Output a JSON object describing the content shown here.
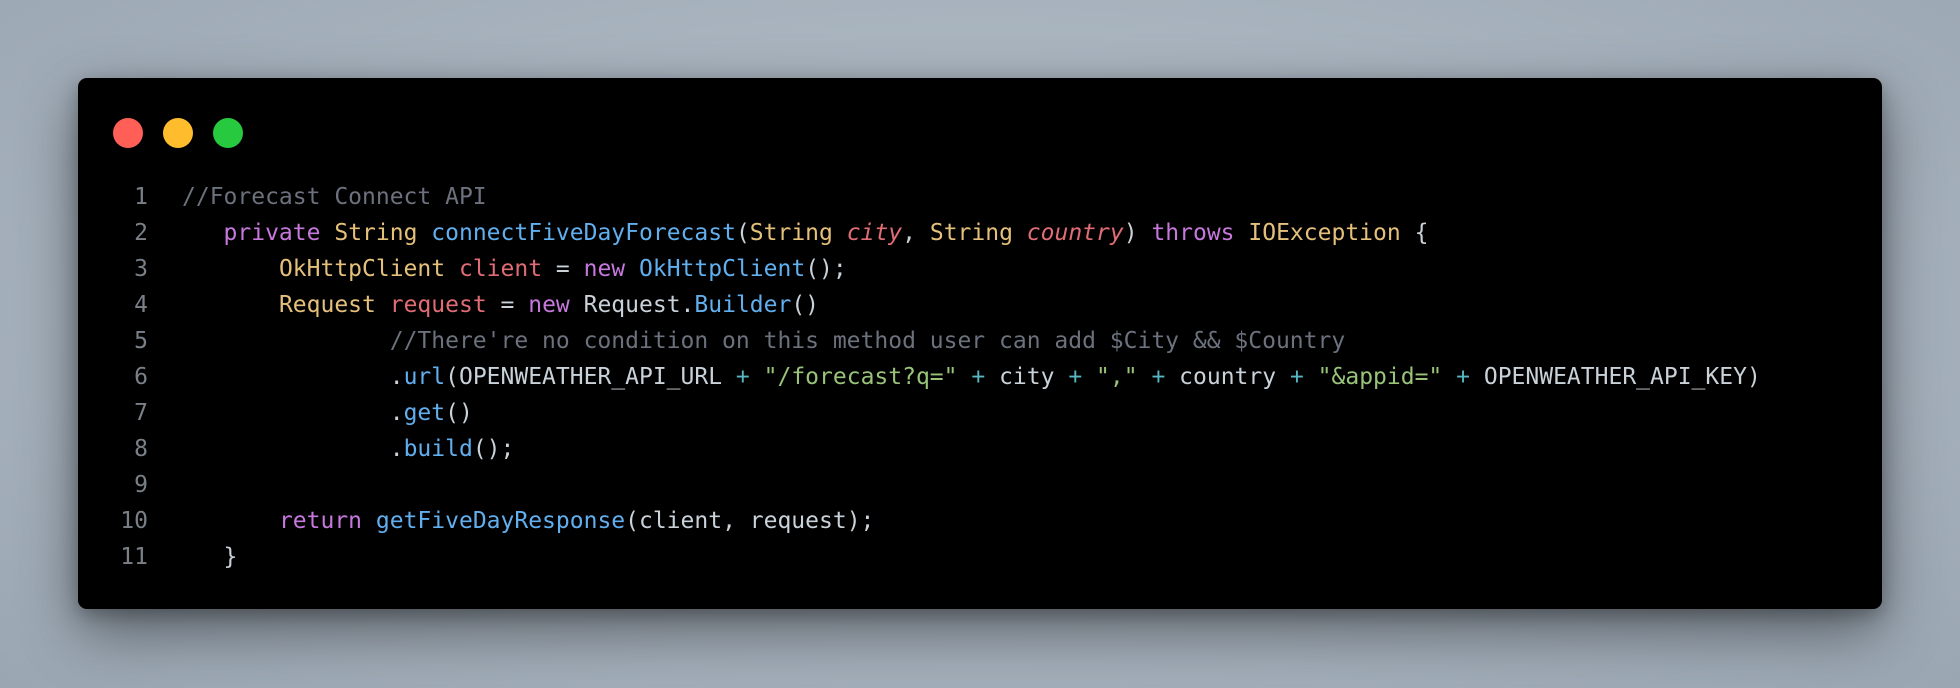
{
  "window": {
    "controls": [
      {
        "name": "close",
        "color": "#ff5f56"
      },
      {
        "name": "minimize",
        "color": "#ffbd2e"
      },
      {
        "name": "maximize",
        "color": "#27c93f"
      }
    ]
  },
  "code": {
    "language": "java",
    "lines": [
      {
        "number": "1",
        "indent": "",
        "tokens": [
          {
            "t": "cm",
            "v": "//Forecast Connect API"
          }
        ]
      },
      {
        "number": "2",
        "indent": "   ",
        "tokens": [
          {
            "t": "kw",
            "v": "private"
          },
          {
            "t": "pl",
            "v": " "
          },
          {
            "t": "ty",
            "v": "String"
          },
          {
            "t": "pl",
            "v": " "
          },
          {
            "t": "fn",
            "v": "connectFiveDayForecast"
          },
          {
            "t": "pl",
            "v": "("
          },
          {
            "t": "ty",
            "v": "String"
          },
          {
            "t": "pl",
            "v": " "
          },
          {
            "t": "pr",
            "v": "city"
          },
          {
            "t": "pl",
            "v": ", "
          },
          {
            "t": "ty",
            "v": "String"
          },
          {
            "t": "pl",
            "v": " "
          },
          {
            "t": "pr",
            "v": "country"
          },
          {
            "t": "pl",
            "v": ") "
          },
          {
            "t": "kw",
            "v": "throws"
          },
          {
            "t": "pl",
            "v": " "
          },
          {
            "t": "ty",
            "v": "IOException"
          },
          {
            "t": "pl",
            "v": " {"
          }
        ]
      },
      {
        "number": "3",
        "indent": "       ",
        "tokens": [
          {
            "t": "ty",
            "v": "OkHttpClient"
          },
          {
            "t": "pl",
            "v": " "
          },
          {
            "t": "vr",
            "v": "client"
          },
          {
            "t": "pl",
            "v": " = "
          },
          {
            "t": "kw",
            "v": "new"
          },
          {
            "t": "pl",
            "v": " "
          },
          {
            "t": "fn",
            "v": "OkHttpClient"
          },
          {
            "t": "pl",
            "v": "();"
          }
        ]
      },
      {
        "number": "4",
        "indent": "       ",
        "tokens": [
          {
            "t": "ty",
            "v": "Request"
          },
          {
            "t": "pl",
            "v": " "
          },
          {
            "t": "vr",
            "v": "request"
          },
          {
            "t": "pl",
            "v": " = "
          },
          {
            "t": "kw",
            "v": "new"
          },
          {
            "t": "pl",
            "v": " Request."
          },
          {
            "t": "fn",
            "v": "Builder"
          },
          {
            "t": "pl",
            "v": "()"
          }
        ]
      },
      {
        "number": "5",
        "indent": "               ",
        "tokens": [
          {
            "t": "cm",
            "v": "//There're no condition on this method user can add $City && $Country"
          }
        ]
      },
      {
        "number": "6",
        "indent": "               ",
        "tokens": [
          {
            "t": "pl",
            "v": "."
          },
          {
            "t": "fn",
            "v": "url"
          },
          {
            "t": "pl",
            "v": "(OPENWEATHER_API_URL "
          },
          {
            "t": "op",
            "v": "+"
          },
          {
            "t": "pl",
            "v": " "
          },
          {
            "t": "st",
            "v": "\"/forecast?q=\""
          },
          {
            "t": "pl",
            "v": " "
          },
          {
            "t": "op",
            "v": "+"
          },
          {
            "t": "pl",
            "v": " city "
          },
          {
            "t": "op",
            "v": "+"
          },
          {
            "t": "pl",
            "v": " "
          },
          {
            "t": "st",
            "v": "\",\""
          },
          {
            "t": "pl",
            "v": " "
          },
          {
            "t": "op",
            "v": "+"
          },
          {
            "t": "pl",
            "v": " country "
          },
          {
            "t": "op",
            "v": "+"
          },
          {
            "t": "pl",
            "v": " "
          },
          {
            "t": "st",
            "v": "\"&appid=\""
          },
          {
            "t": "pl",
            "v": " "
          },
          {
            "t": "op",
            "v": "+"
          },
          {
            "t": "pl",
            "v": " OPENWEATHER_API_KEY)"
          }
        ]
      },
      {
        "number": "7",
        "indent": "               ",
        "tokens": [
          {
            "t": "pl",
            "v": "."
          },
          {
            "t": "fn",
            "v": "get"
          },
          {
            "t": "pl",
            "v": "()"
          }
        ]
      },
      {
        "number": "8",
        "indent": "               ",
        "tokens": [
          {
            "t": "pl",
            "v": "."
          },
          {
            "t": "fn",
            "v": "build"
          },
          {
            "t": "pl",
            "v": "();"
          }
        ]
      },
      {
        "number": "9",
        "indent": "",
        "tokens": []
      },
      {
        "number": "10",
        "indent": "       ",
        "tokens": [
          {
            "t": "kw",
            "v": "return"
          },
          {
            "t": "pl",
            "v": " "
          },
          {
            "t": "fn",
            "v": "getFiveDayResponse"
          },
          {
            "t": "pl",
            "v": "(client, request);"
          }
        ]
      },
      {
        "number": "11",
        "indent": "   ",
        "tokens": [
          {
            "t": "pl",
            "v": "}"
          }
        ]
      }
    ]
  }
}
